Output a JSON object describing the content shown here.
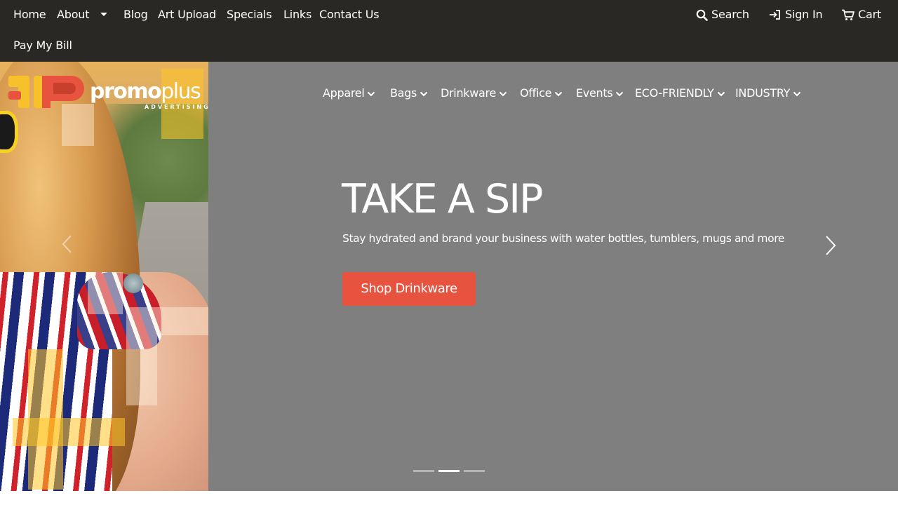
{
  "topnav": {
    "items": [
      {
        "label": "Home"
      },
      {
        "label": "About"
      },
      {
        "label": "Blog"
      },
      {
        "label": "Art Upload"
      },
      {
        "label": "Specials"
      },
      {
        "label": "Links"
      },
      {
        "label": "Contact Us"
      },
      {
        "label": "Pay My Bill"
      }
    ],
    "search_label": "Search",
    "signin_label": "Sign In",
    "cart_label": "Cart"
  },
  "brand": {
    "name_part1": "promo",
    "name_part2": "plus",
    "tagline": "ADVERTISING",
    "colors": {
      "yellow": "#f7c12b",
      "red": "#e8533f"
    }
  },
  "category_nav": [
    {
      "label": "Apparel"
    },
    {
      "label": "Bags"
    },
    {
      "label": "Drinkware"
    },
    {
      "label": "Office"
    },
    {
      "label": "Events"
    },
    {
      "label": "ECO-FRIENDLY"
    },
    {
      "label": "INDUSTRY"
    }
  ],
  "hero": {
    "headline": "TAKE A SIP",
    "subline": "Stay hydrated and brand your business with water bottles, tumblers, mugs and more",
    "cta_label": "Shop Drinkware",
    "cta_color": "#e8533f",
    "background": "#7f7f7f",
    "slides": {
      "count": 3,
      "active": 2
    }
  },
  "icons": [
    "search-icon",
    "sign-in-icon",
    "cart-icon",
    "chevron-down-icon",
    "chevron-right-icon",
    "chevron-left-icon"
  ]
}
